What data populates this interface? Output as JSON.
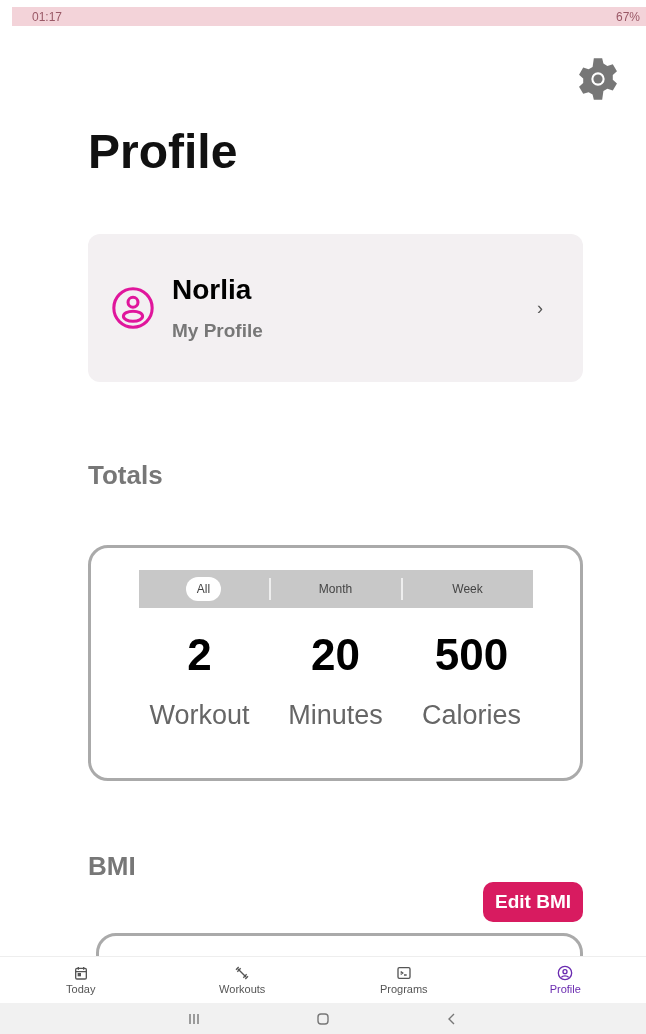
{
  "status_bar": {
    "time": "01:17",
    "battery": "67%"
  },
  "title": "Profile",
  "profile_card": {
    "name": "Norlia",
    "subtitle": "My Profile",
    "chevron": "›"
  },
  "totals": {
    "heading": "Totals",
    "tabs": [
      {
        "label": "All",
        "selected": true
      },
      {
        "label": "Month",
        "selected": false
      },
      {
        "label": "Week",
        "selected": false
      }
    ],
    "stats": [
      {
        "value": "2",
        "label": "Workout"
      },
      {
        "value": "20",
        "label": "Minutes"
      },
      {
        "value": "500",
        "label": "Calories"
      }
    ]
  },
  "bmi": {
    "heading": "BMI",
    "button": "Edit BMI"
  },
  "bottom_nav": [
    {
      "label": "Today",
      "kind": "calendar",
      "selected": false
    },
    {
      "label": "Workouts",
      "kind": "dumbbell",
      "selected": false
    },
    {
      "label": "Programs",
      "kind": "terminal",
      "selected": false
    },
    {
      "label": "Profile",
      "kind": "profile",
      "selected": true
    }
  ]
}
